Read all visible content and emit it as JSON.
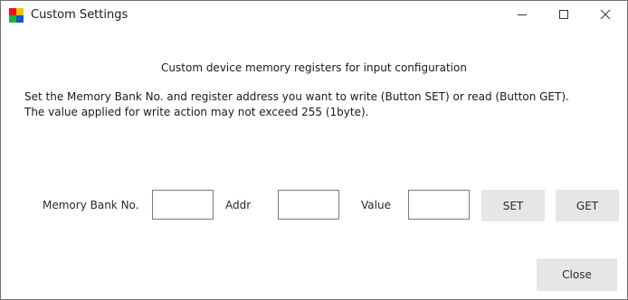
{
  "window": {
    "title": "Custom Settings",
    "icon": "app-icon",
    "controls": [
      "minimize-icon",
      "maximize-icon",
      "close-icon"
    ]
  },
  "main": {
    "heading": "Custom device memory registers for input configuration",
    "instruction_line1": "Set the Memory Bank No. and register address you want to write (Button SET) or read (Button GET).",
    "instruction_line2": "The value applied for write action may not exceed 255 (1byte)."
  },
  "form": {
    "bank_label": "Memory Bank No.",
    "bank_value": "",
    "addr_label": "Addr",
    "addr_value": "",
    "value_label": "Value",
    "value_value": "",
    "set_label": "SET",
    "get_label": "GET"
  },
  "footer": {
    "close_label": "Close"
  },
  "colors": {
    "icon_red": "#e81123",
    "icon_green": "#1fb141",
    "icon_blue": "#0b5cc4",
    "icon_yellow": "#f2c400",
    "button_bg": "#e6e6e6",
    "border": "#7a7a7a"
  }
}
